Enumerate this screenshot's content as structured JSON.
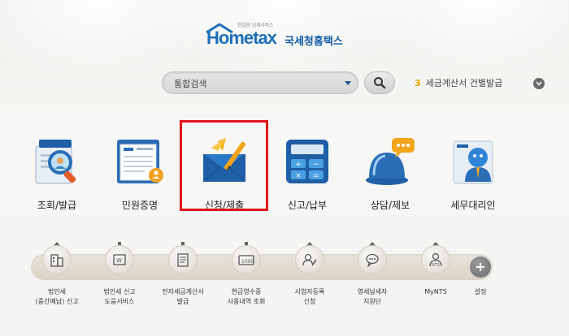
{
  "logo": {
    "tagline": "한걸음 넘세서비스",
    "brand": "Hometax",
    "brand_kr": "국세청홈택스"
  },
  "search": {
    "value": "통합검색",
    "placeholder": "통합검색"
  },
  "notice": {
    "number": "3",
    "text": "세금계산서 건별발급"
  },
  "main_menu": [
    {
      "label": "조회/발급",
      "icon": "magnifier-document-icon"
    },
    {
      "label": "민원증명",
      "icon": "certificate-icon"
    },
    {
      "label": "신청/제출",
      "icon": "envelope-pen-icon"
    },
    {
      "label": "신고/납부",
      "icon": "calculator-icon"
    },
    {
      "label": "상담/제보",
      "icon": "chat-siren-icon"
    },
    {
      "label": "세무대리인",
      "icon": "agent-icon"
    }
  ],
  "sub_menu": [
    {
      "label_line1": "법인세",
      "label_line2": "(중간예납) 신고",
      "icon": "building-upload-icon"
    },
    {
      "label_line1": "법인세 신고",
      "label_line2": "도움서비스",
      "icon": "web-download-icon"
    },
    {
      "label_line1": "전자세금계산서",
      "label_line2": "발급",
      "icon": "invoice-download-icon"
    },
    {
      "label_line1": "현금영수증",
      "label_line2": "사용내역 조회",
      "icon": "receipt-download-icon"
    },
    {
      "label_line1": "사업자등록",
      "label_line2": "신청",
      "icon": "person-pen-upload-icon"
    },
    {
      "label_line1": "영세납세자",
      "label_line2": "지원단",
      "icon": "chat-upload-icon"
    },
    {
      "label_line1": "MyNTS",
      "label_line2": "",
      "icon": "person-nts-upload-icon"
    }
  ],
  "settings": {
    "label": "설정",
    "symbol": "+"
  },
  "colors": {
    "brand_blue": "#1d6fb8",
    "highlight_red": "#e1141c",
    "notice_yellow": "#e0a400"
  },
  "highlighted_item": "신청/제출"
}
